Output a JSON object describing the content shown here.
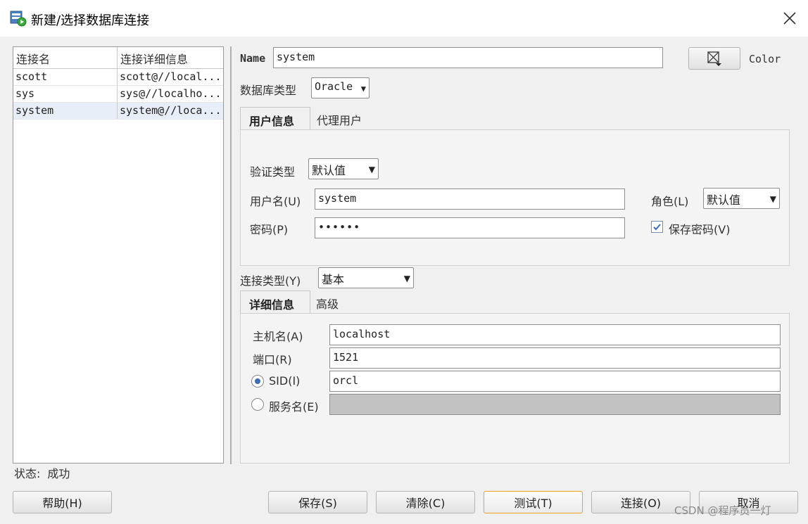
{
  "window": {
    "title": "新建/选择数据库连接"
  },
  "connections": {
    "headers": [
      "连接名",
      "连接详细信息"
    ],
    "rows": [
      {
        "name": "scott",
        "detail": "scott@//local..."
      },
      {
        "name": "sys",
        "detail": "sys@//localho..."
      },
      {
        "name": "system",
        "detail": "system@//loca..."
      }
    ]
  },
  "status": {
    "label": "状态:",
    "value": "成功"
  },
  "form": {
    "name_label": "Name",
    "name_value": "system",
    "color_label": "Color",
    "db_type_label": "数据库类型",
    "db_type_value": "Oracle",
    "tabs_top": [
      "用户信息",
      "代理用户"
    ],
    "auth_type_label": "验证类型",
    "auth_type_value": "默认值",
    "username_label": "用户名(U)",
    "username_value": "system",
    "role_label": "角色(L)",
    "role_value": "默认值",
    "password_label": "密码(P)",
    "password_value": "••••••",
    "save_password_label": "保存密码(V)",
    "save_password_checked": true,
    "conn_type_label": "连接类型(Y)",
    "conn_type_value": "基本",
    "tabs_bottom": [
      "详细信息",
      "高级"
    ],
    "host_label": "主机名(A)",
    "host_value": "localhost",
    "port_label": "端口(R)",
    "port_value": "1521",
    "sid_label": "SID(I)",
    "sid_value": "orcl",
    "service_label": "服务名(E)",
    "service_value": ""
  },
  "buttons": {
    "help": "帮助(H)",
    "save": "保存(S)",
    "clear": "清除(C)",
    "test": "测试(T)",
    "connect": "连接(O)",
    "cancel": "取消"
  },
  "watermark": "CSDN @程序员一灯",
  "colors": {
    "accent": "#3a6db5",
    "focus": "#f0a020"
  }
}
